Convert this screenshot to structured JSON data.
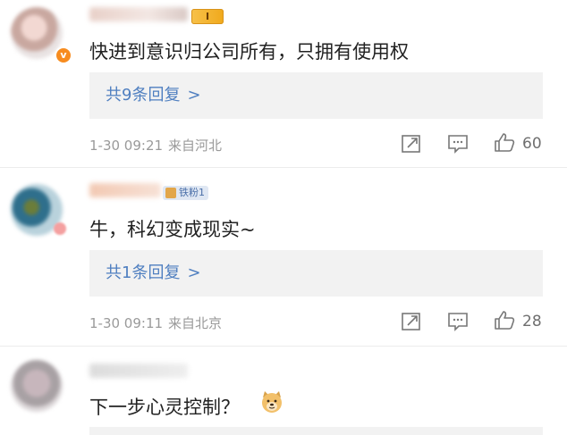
{
  "comments": [
    {
      "text": "快进到意识归公司所有，只拥有使用权",
      "badge": "I",
      "replies_label": "共9条回复",
      "replies_chevron": ">",
      "time": "1-30 09:21",
      "location": "来自河北",
      "likes": "60"
    },
    {
      "text": "牛，科幻变成现实~",
      "badge": "铁粉1",
      "replies_label": "共1条回复",
      "replies_chevron": ">",
      "time": "1-30 09:11",
      "location": "来自北京",
      "likes": "28"
    },
    {
      "text": "下一步心灵控制？",
      "emoji": "doge-emoji"
    }
  ],
  "icons": {
    "verified": "v",
    "share": "share-icon",
    "comment": "comment-icon",
    "like": "like-icon"
  },
  "colors": {
    "link": "#4f7fc0",
    "meta": "#9a9a9a",
    "reply_bg": "#f2f2f2",
    "verified": "#f78c1f"
  }
}
